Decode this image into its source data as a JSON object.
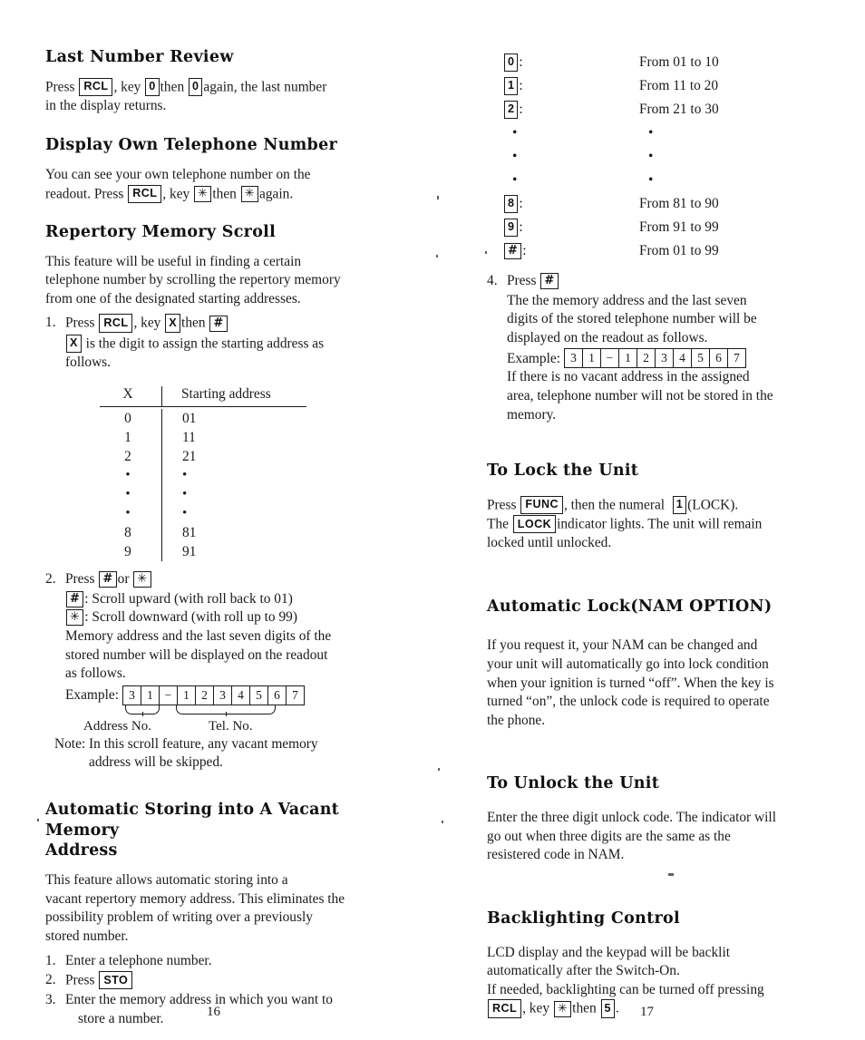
{
  "document": {
    "type": "scanned-manual-page",
    "left_page_number": "16",
    "right_page_number": "17"
  },
  "left_column": {
    "last_number_review": {
      "heading": "Last Number Review",
      "line1_a": "Press",
      "key_rcl": "RCL",
      "line1_b": ", key",
      "key_0a": "0",
      "line1_c": "then",
      "key_0b": "0",
      "line1_d": "again, the last number",
      "line2": "in the display returns."
    },
    "display_own_number": {
      "heading": "Display Own Telephone Number",
      "line1": "You can see your own telephone number on the",
      "line2_a": "readout. Press",
      "key_rcl": "RCL",
      "line2_b": ", key",
      "key_star1": "✳",
      "line2_c": "then",
      "key_star2": "✳",
      "line2_d": "again."
    },
    "repertory_scroll": {
      "heading": "Repertory Memory Scroll",
      "intro_line1": "This feature will be useful in finding a certain",
      "intro_line2": "telephone number by scrolling the repertory memory",
      "intro_line3": "from one of the designated starting addresses.",
      "step1_num": "1.",
      "step1_a": "Press",
      "step1_key_rcl": "RCL",
      "step1_b": ", key",
      "step1_key_x": "X",
      "step1_c": "then",
      "step1_key_hash": "#",
      "step1_sub_key_x": "X",
      "step1_sub_a": "is the digit to assign the starting address as",
      "step1_sub_b": "follows.",
      "table": {
        "header_x": "X",
        "header_addr": "Starting address",
        "rows": [
          {
            "x": "0",
            "addr": "01"
          },
          {
            "x": "1",
            "addr": "11"
          },
          {
            "x": "2",
            "addr": "21"
          },
          {
            "x": "•",
            "addr": "•"
          },
          {
            "x": "•",
            "addr": "•"
          },
          {
            "x": "•",
            "addr": "•"
          },
          {
            "x": "8",
            "addr": "81"
          },
          {
            "x": "9",
            "addr": "91"
          }
        ]
      },
      "step2_num": "2.",
      "step2_a": "Press",
      "step2_key_hash": "#",
      "step2_b": "or",
      "step2_key_star": "✳",
      "scroll_up_key": "#",
      "scroll_up_text": ": Scroll upward (with roll back to 01)",
      "scroll_down_key": "✳",
      "scroll_down_text": ": Scroll downward (with roll up to 99)",
      "readout_line1": "Memory address and the last seven digits of the",
      "readout_line2": "stored number will be displayed on the readout",
      "readout_line3": "as follows.",
      "example_label": "Example:",
      "example_cells": [
        "3",
        "1",
        "−",
        "1",
        "2",
        "3",
        "4",
        "5",
        "6",
        "7"
      ],
      "caption_address": "Address No.",
      "caption_tel": "Tel. No.",
      "note_line1": "Note: In this scroll feature, any vacant memory",
      "note_line2": "address will be skipped."
    },
    "auto_storing": {
      "heading_line1": "Automatic Storing into A Vacant Memory",
      "heading_line2": "Address",
      "intro_line1": "This feature allows automatic storing into a",
      "intro_line2": "vacant repertory memory address. This eliminates the",
      "intro_line3": "possibility problem of writing over a previously",
      "intro_line4": "stored number.",
      "step1_num": "1.",
      "step1_text": "Enter a telephone number.",
      "step2_num": "2.",
      "step2_text": "Press",
      "step2_key_sto": "STO",
      "step3_num": "3.",
      "step3_line1": "Enter the memory address in which you want to",
      "step3_line2": "store a number."
    }
  },
  "right_column": {
    "address_ranges": {
      "rows": [
        {
          "key": "0",
          "type": "key",
          "range": "From 01 to 10"
        },
        {
          "key": "1",
          "type": "key",
          "range": "From 11 to 20"
        },
        {
          "key": "2",
          "type": "key",
          "range": "From 21 to 30"
        },
        {
          "key": "•",
          "type": "dot",
          "range": "•"
        },
        {
          "key": "•",
          "type": "dot",
          "range": "•"
        },
        {
          "key": "•",
          "type": "dot",
          "range": "•"
        },
        {
          "key": "8",
          "type": "key",
          "range": "From 81 to 90"
        },
        {
          "key": "9",
          "type": "key",
          "range": "From 91 to 99"
        },
        {
          "key": "#",
          "type": "key",
          "range": "From 01 to 99"
        }
      ]
    },
    "step4": {
      "num": "4.",
      "press_label": "Press",
      "key_hash": "#",
      "line1": "The the memory address and the last seven",
      "line2": "digits of the stored telephone number will be",
      "line3": "displayed on the readout as follows.",
      "example_label": "Example:",
      "example_cells": [
        "3",
        "1",
        "−",
        "1",
        "2",
        "3",
        "4",
        "5",
        "6",
        "7"
      ],
      "line4": "If there is no vacant address in the assigned",
      "line5": "area, telephone number will not be stored in the",
      "line6": "memory."
    },
    "to_lock": {
      "heading": "To Lock the Unit",
      "line1_a": "Press",
      "key_func": "FUNC",
      "line1_b": ", then the numeral",
      "key_1": "1",
      "line1_c": "(LOCK).",
      "line2_a": "The",
      "key_lock": "LOCK",
      "line2_b": "indicator lights. The unit will remain",
      "line3": "locked until unlocked."
    },
    "automatic_lock": {
      "heading": "Automatic Lock(NAM OPTION)",
      "line1": "If you request it, your NAM can be changed and",
      "line2": "your unit will automatically go into lock condition",
      "line3": "when your ignition is turned “off”. When the key is",
      "line4": "turned “on”, the unlock code is required to operate",
      "line5": "the phone."
    },
    "to_unlock": {
      "heading": "To Unlock the Unit",
      "line1": "Enter the three digit unlock code. The indicator will",
      "line2": "go out when three digits are the same as the",
      "line3": "resistered code in NAM."
    },
    "backlighting": {
      "heading": "Backlighting Control",
      "line1": "LCD display and the keypad will be backlit",
      "line2": "automatically after the Switch-On.",
      "line3": "If needed, backlighting can be turned off pressing",
      "line4_key_rcl": "RCL",
      "line4_a": ", key",
      "line4_key_star": "✳",
      "line4_b": "then",
      "line4_key_5": "5",
      "line4_c": "."
    }
  }
}
